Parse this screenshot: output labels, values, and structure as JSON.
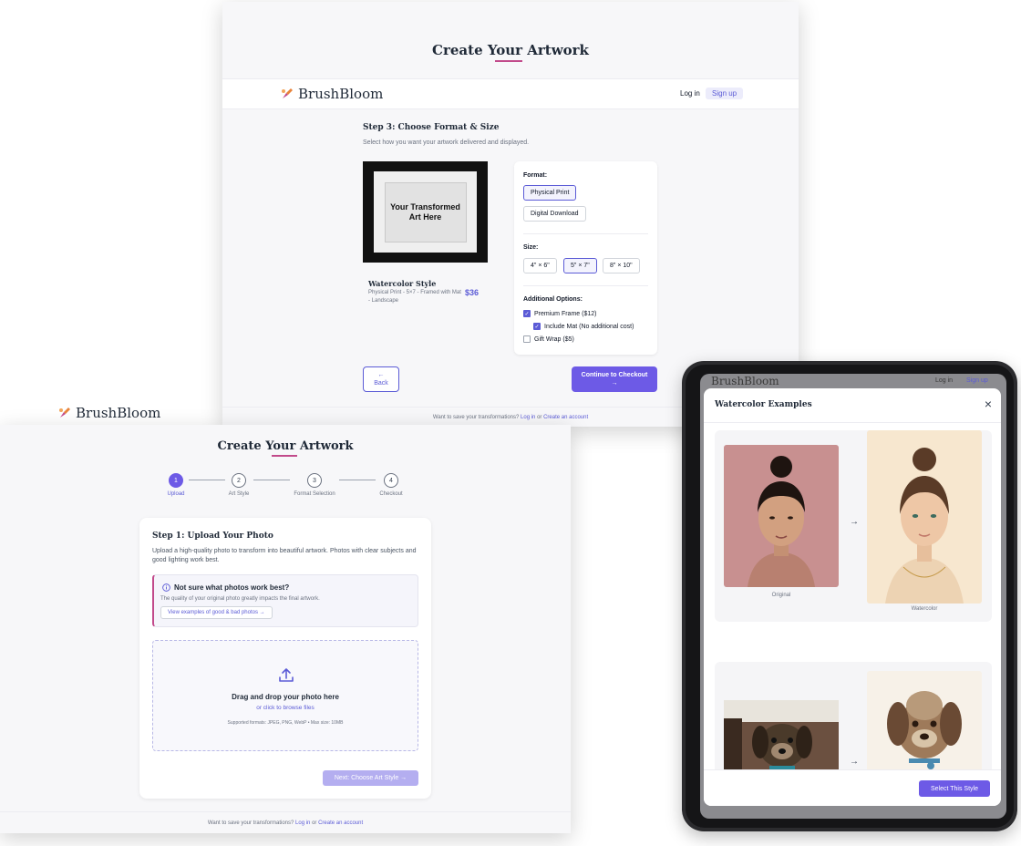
{
  "brand": {
    "name": "BrushBloom"
  },
  "format_page": {
    "hero_title": "Create Your Artwork",
    "nav": {
      "login": "Log in",
      "signup": "Sign up"
    },
    "step_title": "Step 3: Choose Format & Size",
    "step_desc": "Select how you want your artwork delivered and displayed.",
    "preview_text": "Your Transformed Art Here",
    "summary": {
      "title": "Watercolor Style",
      "desc": "Physical Print - 5×7 - Framed with Mat - Landscape",
      "price": "$36"
    },
    "format_label": "Format:",
    "formats": [
      "Physical Print",
      "Digital Download"
    ],
    "size_label": "Size:",
    "sizes": [
      "4\" × 6\"",
      "5\" × 7\"",
      "8\" × 10\""
    ],
    "additional_label": "Additional Options:",
    "options": [
      "Premium Frame ($12)",
      "Include Mat (No additional cost)",
      "Gift Wrap ($5)"
    ],
    "back_label": "Back",
    "continue_label": "Continue to Checkout",
    "footer": {
      "text": "Want to save your transformations?",
      "login": "Log in",
      "or": "or",
      "create": "Create an account"
    }
  },
  "upload_page": {
    "hero_title": "Create Your Artwork",
    "steps": [
      {
        "num": "1",
        "label": "Upload"
      },
      {
        "num": "2",
        "label": "Art Style"
      },
      {
        "num": "3",
        "label": "Format Selection"
      },
      {
        "num": "4",
        "label": "Checkout"
      }
    ],
    "step_title": "Step 1: Upload Your Photo",
    "step_desc": "Upload a high-quality photo to transform into beautiful artwork. Photos with clear subjects and good lighting work best.",
    "tip_title": "Not sure what photos work best?",
    "tip_desc": "The quality of your original photo greatly impacts the final artwork.",
    "tip_link": "View examples of good & bad photos →",
    "drop_title": "Drag and drop your photo here",
    "drop_link": "or click to browse files",
    "drop_formats": "Supported formats: JPEG, PNG, WebP • Max size: 10MB",
    "next_label": "Next: Choose Art Style →",
    "footer": {
      "text": "Want to save your transformations?",
      "login": "Log in",
      "or": "or",
      "create": "Create an account"
    }
  },
  "tablet_modal": {
    "behind_nav": {
      "login": "Log in",
      "signup": "Sign up"
    },
    "title": "Watercolor Examples",
    "captions": {
      "original": "Original",
      "watercolor": "Watercolor"
    },
    "select_label": "Select This Style"
  },
  "colors": {
    "accent": "#6d5ae6",
    "link": "#5b5bd6",
    "underline": "#c24a8b"
  }
}
